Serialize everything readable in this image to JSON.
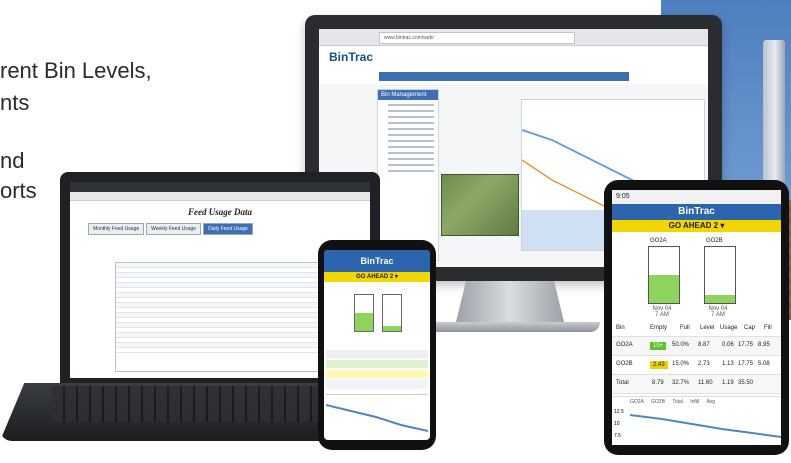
{
  "marketing": {
    "line1": "rent Bin Levels,",
    "line2": "nts",
    "line3": "nd",
    "line4": "orts"
  },
  "monitor": {
    "browser_url": "www.bintrac.com/web/",
    "logo": "BinTrac",
    "sidebar_title": "Bin Management"
  },
  "laptop": {
    "page_title": "Feed Usage Data",
    "tabs": [
      "Monthly Feed Usage",
      "Weekly Feed Usage",
      "Daily Feed Usage"
    ]
  },
  "phone": {
    "app_title": "BinTrac",
    "bin_name": "GO AHEAD 2 ▾"
  },
  "tablet": {
    "status_time": "9:05",
    "app_title": "BinTrac",
    "bin_name": "GO AHEAD 2 ▾",
    "silo_a_label": "GO2A",
    "silo_b_label": "GO2B",
    "silo_a_date": "Nov 04",
    "silo_a_time": "7 AM",
    "silo_b_date": "Nov 04",
    "silo_b_time": "7 AM",
    "headers": [
      "Bin",
      "Empty",
      "Full",
      "Level",
      "Usage",
      "Cap",
      "Fill"
    ],
    "rows": [
      {
        "bin": "GO2A",
        "empty": "10+",
        "full": "50.0%",
        "level": "8.87",
        "usage": "0.06",
        "cap": "17.75",
        "fill": "8.95"
      },
      {
        "bin": "GO2B",
        "empty": "2.43",
        "full": "15.0%",
        "level": "2.73",
        "usage": "1.13",
        "cap": "17.75",
        "fill": "5.08"
      },
      {
        "bin": "Total",
        "empty": "8.79",
        "full": "32.7%",
        "level": "11.60",
        "usage": "1.19",
        "cap": "35.50",
        "fill": ""
      }
    ],
    "legend": [
      "GO2A",
      "GO2B",
      "Total",
      "Infill",
      "Avg"
    ],
    "chart_y_ticks": [
      "12.5",
      "10",
      "7.5"
    ]
  }
}
